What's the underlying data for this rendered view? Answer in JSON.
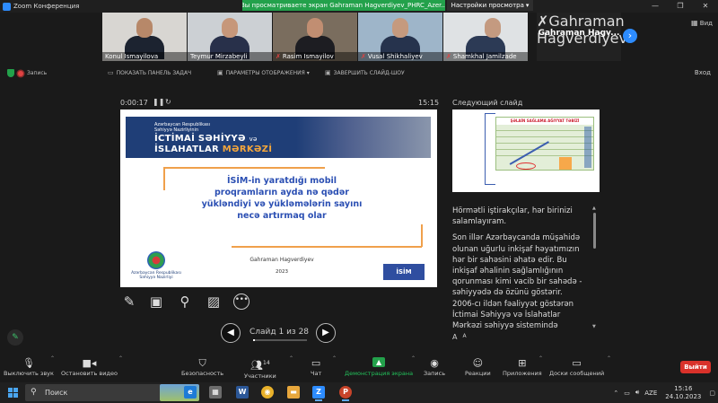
{
  "titlebar": {
    "app_title": "Zoom Конференция",
    "viewing_banner": "Вы просматриваете экран Gahraman Hagverdiyev_PHRC_Azer...",
    "view_settings": "Настройки просмотра",
    "view_settings_caret": "▾"
  },
  "participants": [
    {
      "name": "Konul Ismayilova",
      "muted": false
    },
    {
      "name": "Teymur Mirzabeyli",
      "muted": false
    },
    {
      "name": "Rasim Ismayilov",
      "muted": true
    },
    {
      "name": "Vusal Shikhaliyev",
      "muted": true
    },
    {
      "name": "Shamkhal Jamilzade",
      "muted": true
    },
    {
      "name": "Gahraman Hagverdiyev",
      "muted": true,
      "display": "Gahraman  Hagv..."
    }
  ],
  "thumb_view_label": "Вид",
  "sharebar": {
    "recording": "Запись",
    "hide_taskbar": "ПОКАЗАТЬ ПАНЕЛЬ ЗАДАЧ",
    "display_settings": "ПАРАМЕТРЫ ОТОБРАЖЕНИЯ ▾",
    "end_show": "ЗАВЕРШИТЬ СЛАЙД-ШОУ",
    "exit": "Вход"
  },
  "presenter": {
    "timer": "0:00:17",
    "clock": "15:15",
    "slide_counter": "Слайд 1 из 28",
    "current_slide_number": 1,
    "total_slides": 28,
    "next_slide_label": "Следующий слайд",
    "font_controls": [
      "A",
      "A"
    ]
  },
  "slide": {
    "ministry_line1": "Azərbaycan Respublikası",
    "ministry_line2": "Səhiyyə Nazirliyinin",
    "title_line1": "İCTİMAİ SƏHİYYƏ",
    "title_line1_suffix": "və",
    "title_line2": "İSLAHATLAR",
    "title_line2_accent": "MƏRKƏZİ",
    "headline": "İSİM-in yaratdığı mobil proqramların ayda nə qədər yükləndiyi və yükləmələrin sayını necə artırmaq olar",
    "author": "Gahraman Hagverdiyev",
    "year": "2023",
    "emblem_caption": "Azərbaycan Respublikası Səhiyyə Nazirliyi",
    "logo_text": "İSİM"
  },
  "next_slide": {
    "table_title": "ŞƏLAİN SAĞLAMA AĞIYYAT TƏBİZİ"
  },
  "notes": [
    "Hörmətli iştirakçılar, hər birinizi salamlayıram.",
    "Son illər Azərbaycanda müşahidə olunan uğurlu inkişaf həyatımızın hər bir sahəsini əhatə edir. Bu inkişaf əhalinin sağlamlığının qorunması kimi vacib bir sahədə - səhiyyədə də özünü göstərir. 2006-cı ildən fəaliyyət göstərən İctimai Səhiyyə və İslahatlar Mərkəzi səhiyyə sistemində"
  ],
  "bottombar": {
    "mute": "Выключить звук",
    "stop_video": "Остановить видео",
    "security": "Безопасность",
    "participants": "Участники",
    "participants_count": "14",
    "chat": "Чат",
    "share": "Демонстрация экрана",
    "record": "Запись",
    "reactions": "Реакции",
    "apps": "Приложения",
    "whiteboard": "Доски сообщений",
    "leave": "Выйти"
  },
  "taskbar": {
    "search_placeholder": "Поиск",
    "language": "AZE",
    "time": "15:16",
    "date": "24.10.2023"
  },
  "colors": {
    "zoom_blue": "#2d8cff",
    "share_green": "#23a14b",
    "leave_red": "#d9312a",
    "slide_title_blue": "#2b4fb3",
    "slide_banner": "#1f3e77"
  }
}
